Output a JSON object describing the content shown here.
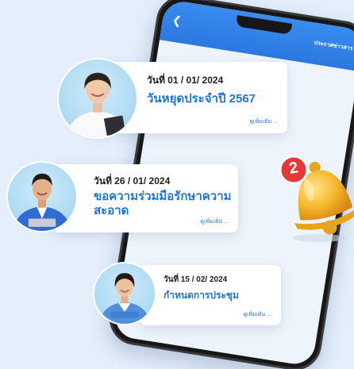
{
  "phone": {
    "back_icon": "chevron-left-icon",
    "title": "ประกาศข่าวสาร"
  },
  "notifications": [
    {
      "date": "วันที่ 01 / 01/ 2024",
      "title": "วันหยุดประจำปี 2567",
      "more": "ดูเพิ่มเติม ..."
    },
    {
      "date": "วันที่ 26 / 01/ 2024",
      "title": "ขอความร่วมมือรักษาความสะอาด",
      "more": "ดูเพิ่มเติม ..."
    },
    {
      "date": "วันที่ 15 / 02/ 2024",
      "title": "กำหนดการประชุม",
      "more": "ดูเพิ่มเติม ..."
    }
  ],
  "bell": {
    "badge": "2"
  },
  "colors": {
    "accent": "#1f74d9",
    "background": "#e4effb",
    "bell": "#f6b92e",
    "badge": "#e53935"
  }
}
